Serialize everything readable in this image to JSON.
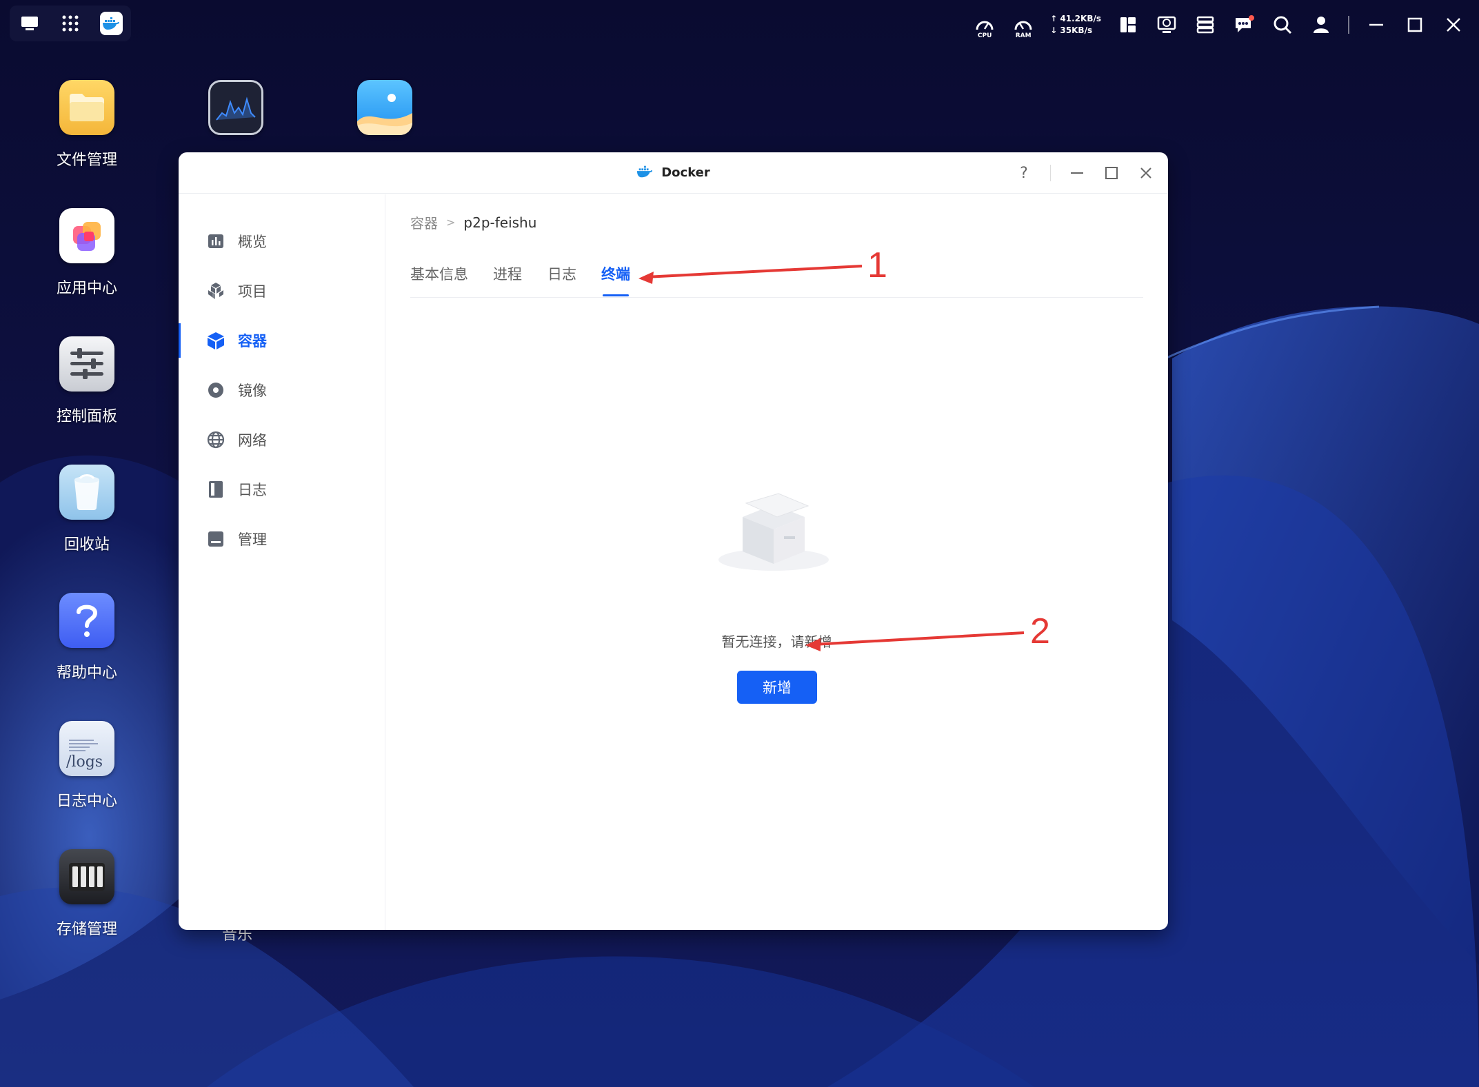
{
  "desktop": {
    "apps": [
      {
        "label": "文件管理",
        "icon": "folder-icon"
      },
      {
        "label": "应用中心",
        "icon": "app-center-icon"
      },
      {
        "label": "控制面板",
        "icon": "control-panel-icon"
      },
      {
        "label": "回收站",
        "icon": "recycle-bin-icon"
      },
      {
        "label": "帮助中心",
        "icon": "help-icon"
      },
      {
        "label": "日志中心",
        "icon": "logs-icon",
        "tile_text": "/logs"
      },
      {
        "label": "存储管理",
        "icon": "storage-icon"
      }
    ],
    "top_apps": [
      {
        "icon": "resource-monitor-icon"
      },
      {
        "icon": "photos-icon"
      }
    ],
    "partial_label": "音乐"
  },
  "system_bar": {
    "cpu_label": "CPU",
    "ram_label": "RAM",
    "upload_speed": "↑ 41.2KB/s",
    "download_speed": "↓ 35KB/s"
  },
  "window": {
    "title": "Docker",
    "help_symbol": "?",
    "sidebar": {
      "items": [
        {
          "label": "概览",
          "icon": "overview-icon"
        },
        {
          "label": "项目",
          "icon": "project-icon"
        },
        {
          "label": "容器",
          "icon": "container-icon",
          "active": true
        },
        {
          "label": "镜像",
          "icon": "image-icon"
        },
        {
          "label": "网络",
          "icon": "network-icon"
        },
        {
          "label": "日志",
          "icon": "log-icon"
        },
        {
          "label": "管理",
          "icon": "manage-icon"
        }
      ]
    },
    "breadcrumb": {
      "root": "容器",
      "separator": ">",
      "current": "p2p-feishu"
    },
    "tabs": [
      {
        "label": "基本信息"
      },
      {
        "label": "进程"
      },
      {
        "label": "日志"
      },
      {
        "label": "终端",
        "active": true
      }
    ],
    "empty_state": {
      "message": "暂无连接，请新增"
    },
    "add_button_label": "新增"
  },
  "annotations": [
    {
      "number": "1",
      "color": "#e53935"
    },
    {
      "number": "2",
      "color": "#e53935"
    }
  ],
  "colors": {
    "accent": "#1560f5",
    "annotation": "#e53935"
  }
}
